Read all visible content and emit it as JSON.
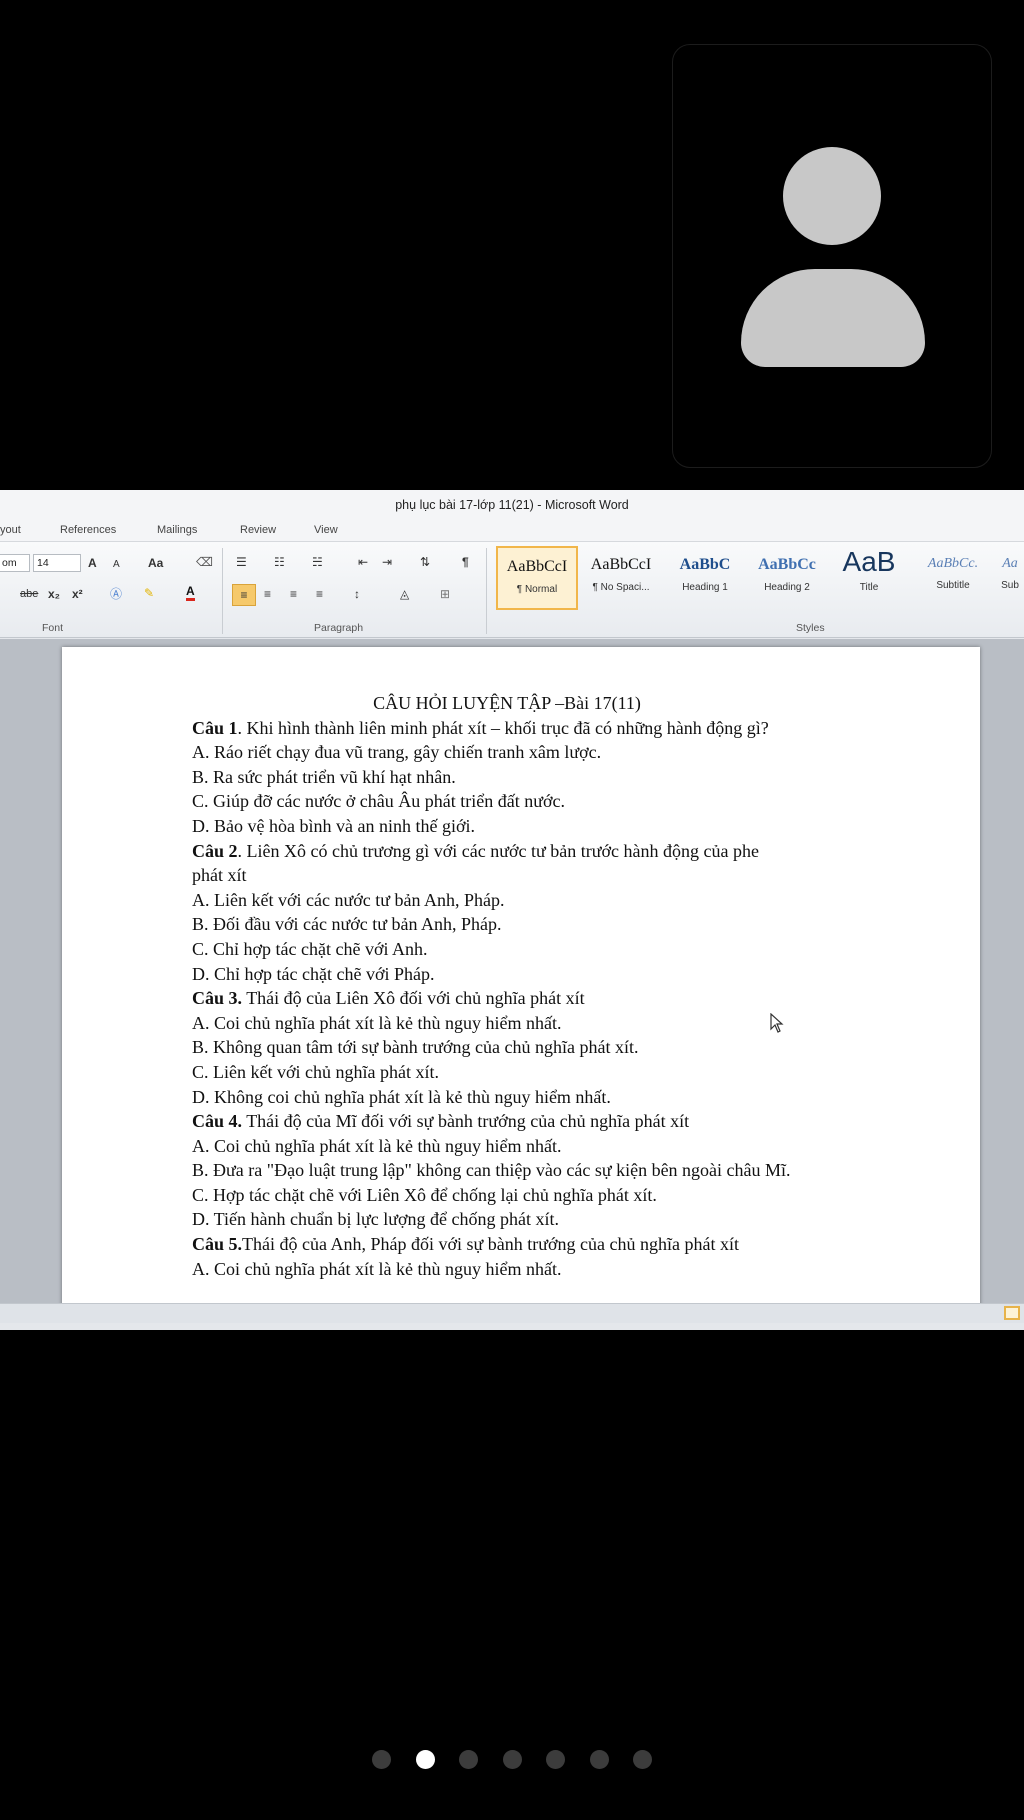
{
  "window": {
    "title": "phụ lục bài 17-lớp 11(21) - Microsoft Word"
  },
  "menu": [
    "yout",
    "References",
    "Mailings",
    "Review",
    "View"
  ],
  "ribbon": {
    "font_name": "om",
    "font_size": "14",
    "grow_font": "A",
    "shrink_font": "A",
    "change_case": "Aa",
    "strike": "abe",
    "subscript": "x₂",
    "superscript": "x²",
    "font_color_glyph": "A",
    "pilcrow": "¶",
    "groups": {
      "font": "Font",
      "paragraph": "Paragraph",
      "styles": "Styles"
    },
    "styles": [
      {
        "sample": "AaBbCcI",
        "name": "¶ Normal",
        "color": "#111111"
      },
      {
        "sample": "AaBbCcI",
        "name": "¶ No Spaci...",
        "color": "#111111"
      },
      {
        "sample": "AaBbC",
        "name": "Heading 1",
        "color": "#1f4e8c"
      },
      {
        "sample": "AaBbCc",
        "name": "Heading 2",
        "color": "#3f6fb0"
      },
      {
        "sample": "AaB",
        "name": "Title",
        "color": "#17365d"
      },
      {
        "sample": "AaBbCc.",
        "name": "Subtitle",
        "color": "#5a7fb5"
      },
      {
        "sample": "Aa",
        "name": "Sub",
        "color": "#5a7fb5"
      }
    ]
  },
  "document": {
    "title": "CÂU HỎI LUYỆN TẬP –Bài 17(11)",
    "lines": [
      {
        "label": "Câu 1",
        "text": ". Khi hình thành liên minh phát xít – khối trục đã có những hành động gì?"
      },
      {
        "label": "",
        "text": "A. Ráo riết chạy đua vũ trang, gây chiến tranh xâm lược."
      },
      {
        "label": "",
        "text": "B. Ra sức phát triển vũ khí hạt nhân."
      },
      {
        "label": "",
        "text": "C. Giúp đỡ các nước ở châu Âu phát triển đất nước."
      },
      {
        "label": "",
        "text": "D. Bảo vệ hòa bình và an ninh thế giới."
      },
      {
        "label": "Câu 2",
        "text": ". Liên Xô có chủ trương gì với các nước tư bản trước hành động của phe"
      },
      {
        "label": "",
        "text": "phát xít"
      },
      {
        "label": "",
        "text": "A. Liên kết với các nước tư bản Anh, Pháp."
      },
      {
        "label": "",
        "text": "B. Đối đầu với các nước tư bản Anh, Pháp."
      },
      {
        "label": "",
        "text": "C. Chỉ hợp tác chặt chẽ với Anh."
      },
      {
        "label": "",
        "text": "D. Chỉ hợp tác chặt chẽ với Pháp."
      },
      {
        "label": "Câu 3.",
        "text": " Thái độ của Liên Xô đối với chủ nghĩa phát xít"
      },
      {
        "label": "",
        "text": "A. Coi chủ nghĩa phát xít là kẻ thù nguy hiểm nhất."
      },
      {
        "label": "",
        "text": "B. Không quan tâm tới sự bành trướng của chủ nghĩa phát xít."
      },
      {
        "label": "",
        "text": "C. Liên kết với chủ nghĩa phát xít."
      },
      {
        "label": "",
        "text": "D. Không coi chủ nghĩa phát xít là kẻ thù nguy hiểm nhất."
      },
      {
        "label": "Câu 4.",
        "text": " Thái độ của Mĩ đối với sự bành trướng của chủ nghĩa phát xít"
      },
      {
        "label": "",
        "text": "A. Coi chủ nghĩa phát xít là kẻ thù nguy hiểm nhất."
      },
      {
        "label": "",
        "text": "B. Đưa ra \"Đạo luật trung lập\" không can thiệp vào các sự kiện bên ngoài châu Mĩ."
      },
      {
        "label": "",
        "text": "C. Hợp tác chặt chẽ với Liên Xô để chống lại chủ nghĩa phát xít."
      },
      {
        "label": "",
        "text": "D. Tiến hành chuẩn bị lực lượng để chống phát xít."
      },
      {
        "label": "Câu 5.",
        "text": "Thái độ của Anh, Pháp đối với sự bành trướng của chủ nghĩa phát xít"
      },
      {
        "label": "",
        "text": "A. Coi chủ nghĩa phát xít là kẻ thù nguy hiểm nhất."
      }
    ]
  },
  "pager": {
    "count": 7,
    "active_index": 1
  },
  "colors": {
    "avatar": "#c8c8c8",
    "selected_style": "#f1b64a",
    "dot_active": "#ffffff",
    "dot_inactive": "#3c3c3c"
  },
  "icons": {
    "participant": "person-icon",
    "mouse_pointer": "cursor-arrow-icon"
  }
}
